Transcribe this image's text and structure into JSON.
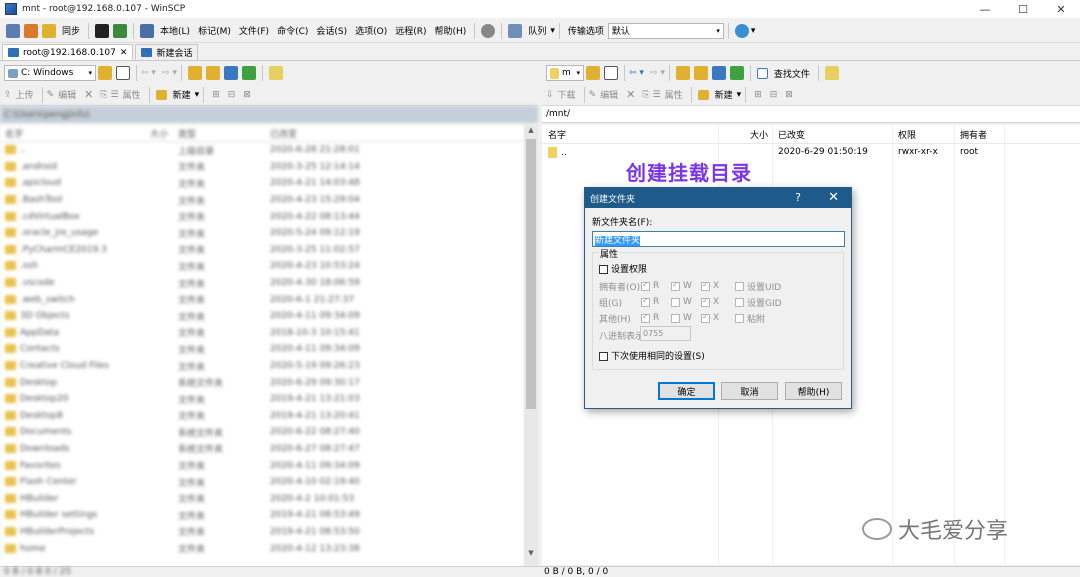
{
  "window": {
    "title": "mnt - root@192.168.0.107 - WinSCP",
    "minimize": "—",
    "maximize": "☐",
    "close": "✕"
  },
  "toolbar": {
    "sync": "同步",
    "menus": [
      "本地(L)",
      "标记(M)",
      "文件(F)",
      "命令(C)",
      "会话(S)",
      "选项(O)",
      "远程(R)",
      "帮助(H)"
    ],
    "queue": "队列",
    "transfer_label": "传输选项",
    "transfer_value": "默认"
  },
  "tabs": [
    {
      "label": "root@192.168.0.107"
    },
    {
      "label": "新建会话"
    }
  ],
  "tab_close": "✕",
  "left": {
    "drive": "C: Windows",
    "actions": {
      "upload": "上传",
      "edit": "编辑",
      "props": "属性",
      "new": "新建"
    },
    "path": "C:\\Users\\pengjinfu\\",
    "headers": [
      "名字",
      "大小",
      "类型",
      "已改变"
    ],
    "rows": [
      [
        "..",
        "",
        "上级目录",
        "2020-6-28 21:28:01"
      ],
      [
        ".android",
        "",
        "文件夹",
        "2020-3-25 12:14:14"
      ],
      [
        ".apicloud",
        "",
        "文件夹",
        "2020-4-21 14:03:48"
      ],
      [
        ".BashTool",
        "",
        "文件夹",
        "2020-4-23 15:29:04"
      ],
      [
        ".cdVirtualBox",
        "",
        "文件夹",
        "2020-4-22 08:13:44"
      ],
      [
        ".oracle_jre_usage",
        "",
        "文件夹",
        "2020-5-24 09:12:19"
      ],
      [
        ".PyCharmCE2019.3",
        "",
        "文件夹",
        "2020-3-25 11:02:57"
      ],
      [
        ".ssh",
        "",
        "文件夹",
        "2020-4-23 10:53:24"
      ],
      [
        ".vscode",
        "",
        "文件夹",
        "2020-4-30 18:06:59"
      ],
      [
        ".web_switch",
        "",
        "文件夹",
        "2020-6-1 21:27:37"
      ],
      [
        "3D Objects",
        "",
        "文件夹",
        "2020-4-11 09:34:09"
      ],
      [
        "AppData",
        "",
        "文件夹",
        "2018-10-3 10:15:41"
      ],
      [
        "Contacts",
        "",
        "文件夹",
        "2020-4-11 09:34:09"
      ],
      [
        "Creative Cloud Files",
        "",
        "文件夹",
        "2020-5-19 09:26:23"
      ],
      [
        "Desktop",
        "",
        "系统文件夹",
        "2020-6-29 09:30:17"
      ],
      [
        "Desktop20",
        "",
        "文件夹",
        "2019-4-21 13:21:03"
      ],
      [
        "Desktop8",
        "",
        "文件夹",
        "2019-4-21 13:20:41"
      ],
      [
        "Documents",
        "",
        "系统文件夹",
        "2020-6-22 08:27:40"
      ],
      [
        "Downloads",
        "",
        "系统文件夹",
        "2020-6-27 08:27:47"
      ],
      [
        "Favorites",
        "",
        "文件夹",
        "2020-4-11 09:34:09"
      ],
      [
        "Flash Center",
        "",
        "文件夹",
        "2020-4-10 02:19:40"
      ],
      [
        "HBuilder",
        "",
        "文件夹",
        "2020-4-2 10:01:53"
      ],
      [
        "HBuilder settings",
        "",
        "文件夹",
        "2019-4-21 08:53:49"
      ],
      [
        "HBuilderProjects",
        "",
        "文件夹",
        "2019-4-21 08:53:50"
      ],
      [
        "home",
        "",
        "文件夹",
        "2020-4-12 13:23:38"
      ]
    ],
    "status": "0 B / 0 B   0 / 25"
  },
  "right": {
    "dir": "m",
    "find": "查找文件",
    "actions": {
      "download": "下载",
      "edit": "编辑",
      "props": "属性",
      "new": "新建"
    },
    "path": "/mnt/",
    "headers": [
      "名字",
      "大小",
      "已改变",
      "权限",
      "拥有者"
    ],
    "rows": [
      [
        "..",
        "",
        "2020-6-29 01:50:19",
        "rwxr-xr-x",
        "root"
      ]
    ],
    "status": "0 B / 0 B,  0 / 0"
  },
  "annotation": "创建挂载目录",
  "dialog": {
    "title": "创建文件夹",
    "help_glyph": "?",
    "close_glyph": "✕",
    "name_label": "新文件夹名(F):",
    "name_value": "新建文件夹",
    "attrs_label": "属性",
    "set_perms": "设置权限",
    "owner": "拥有者(O)",
    "group": "组(G)",
    "others": "其他(H)",
    "r": "R",
    "w": "W",
    "x": "X",
    "setuid": "设置UID",
    "setgid": "设置GID",
    "sticky": "粘附",
    "octal_label": "八进制表示",
    "octal_value": "0755",
    "reuse": "下次使用相同的设置(S)",
    "ok": "确定",
    "cancel": "取消",
    "help": "帮助(H)"
  },
  "watermark": "大毛爱分享"
}
